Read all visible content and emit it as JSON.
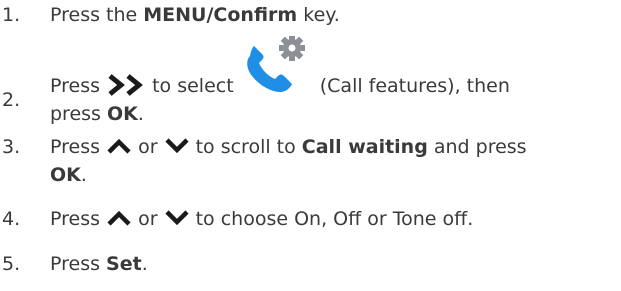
{
  "colors": {
    "text": "#3a3a3a",
    "glyph": "#1a1a1a",
    "phone": "#1e8ee6",
    "gear": "#8c8f93"
  },
  "steps": [
    {
      "number": "1.",
      "before": "Press the ",
      "bold": "MENU/Confirm",
      "after": " key."
    },
    {
      "number": "2.",
      "before": "Press ",
      "icon": "double-chevron-right-icon",
      "middle": " to select ",
      "feature_icon": "call-features-icon",
      "after": " (Call features), then",
      "line2_before": "press ",
      "line2_bold": "OK",
      "line2_after": "."
    },
    {
      "number": "3.",
      "before": "Press ",
      "icon_up": "chevron-up-icon",
      "or": " or ",
      "icon_down": "chevron-down-icon",
      "middle": " to scroll to ",
      "bold": "Call waiting",
      "after": " and press",
      "line2_bold": "OK",
      "line2_after": "."
    },
    {
      "number": "4.",
      "before": "Press ",
      "icon_up": "chevron-up-icon",
      "or": " or ",
      "icon_down": "chevron-down-icon",
      "after": " to choose On, Off or Tone off."
    },
    {
      "number": "5.",
      "before": "Press ",
      "bold": "Set",
      "after": "."
    }
  ]
}
